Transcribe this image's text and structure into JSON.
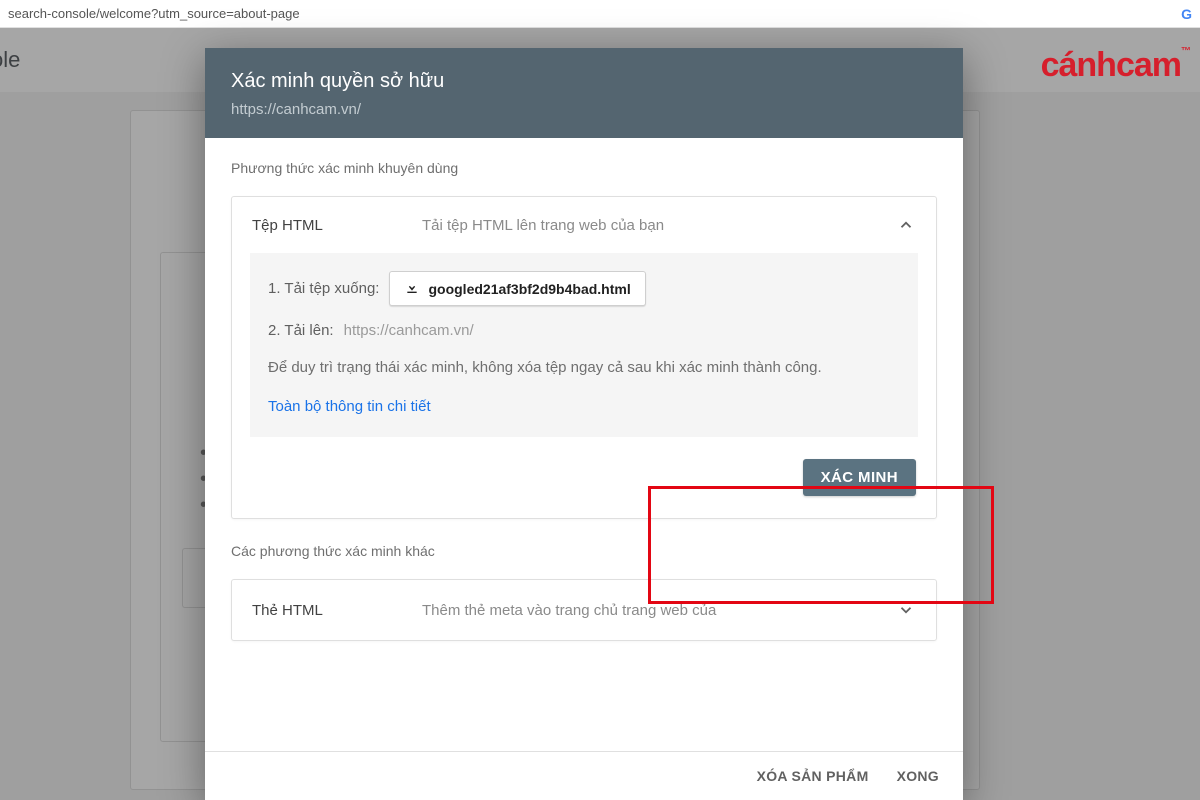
{
  "address_bar": {
    "url_fragment": "search-console/welcome?utm_source=about-page"
  },
  "background": {
    "header_text": "sole"
  },
  "brand": {
    "text": "cánhcam",
    "tm": "™"
  },
  "dialog": {
    "title": "Xác minh quyền sở hữu",
    "site_url": "https://canhcam.vn/",
    "recommended_label": "Phương thức xác minh khuyên dùng",
    "other_label": "Các phương thức xác minh khác",
    "footer": {
      "remove": "XÓA SẢN PHẨM",
      "done": "XONG"
    }
  },
  "method_html_file": {
    "title": "Tệp HTML",
    "desc": "Tải tệp HTML lên trang web của bạn",
    "step1_label": "1. Tải tệp xuống:",
    "download_file": "googled21af3bf2d9b4bad.html",
    "step2_label": "2. Tải lên:",
    "upload_target": "https://canhcam.vn/",
    "note": "Để duy trì trạng thái xác minh, không xóa tệp ngay cả sau khi xác minh thành công.",
    "details_link": "Toàn bộ thông tin chi tiết",
    "verify_button": "XÁC MINH"
  },
  "method_html_tag": {
    "title": "Thẻ HTML",
    "desc": "Thêm thẻ meta vào trang chủ trang web của"
  }
}
